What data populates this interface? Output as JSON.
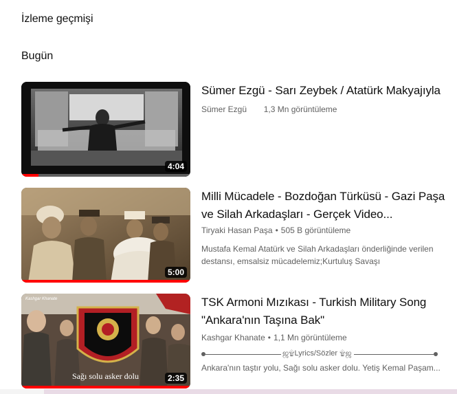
{
  "page": {
    "title": "İzleme geçmişi",
    "section": "Bugün"
  },
  "videos": [
    {
      "title": "Sümer Ezgü - Sarı Zeybek / Atatürk Makyajıyla",
      "channel": "Sümer Ezgü",
      "views": "1,3 Mn görüntüleme",
      "duration": "4:04",
      "watched_fraction": 0.1
    },
    {
      "title": "Milli Mücadele - Bozdoğan Türküsü - Gazi Paşa ve Silah Arkadaşları - Gerçek Video...",
      "channel": "Tiryaki Hasan Paşa",
      "views": "505 B görüntüleme",
      "duration": "5:00",
      "watched_fraction": 1.0,
      "description": "Mustafa Kemal Atatürk ve Silah Arkadaşları önderliğinde verilen destansı, emsalsiz mücadelemiz;Kurtuluş Savaşı"
    },
    {
      "title": "TSK Armoni Mızıkası - Turkish Military Song \"Ankara'nın Taşına Bak\"",
      "channel": "Kashgar Khanate",
      "views": "1,1 Mn görüntüleme",
      "duration": "2:35",
      "watched_fraction": 1.0,
      "lyrics_label": "ஜ۩Lyrics/Sözler ۩ஜ",
      "description": "Ankara'nın taştır yolu, Sağı solu asker dolu. Yetiş Kemal Paşam...",
      "thumb_caption": "Sağı solu asker dolu",
      "thumb_watermark": "Kashgar Khanate"
    }
  ],
  "colors": {
    "progress": "#ff0000",
    "text_primary": "#0f0f0f",
    "text_secondary": "#606060"
  }
}
